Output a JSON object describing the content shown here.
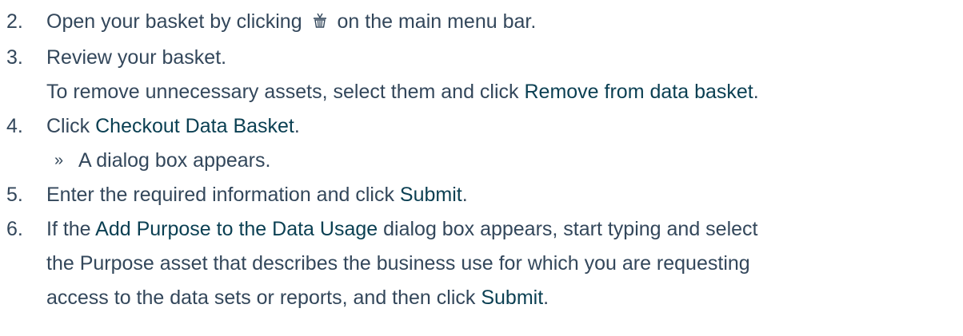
{
  "steps": [
    {
      "number": "2.",
      "text_before": "Open your basket by clicking",
      "icon": "basket-icon",
      "text_after": "on the main menu bar."
    },
    {
      "number": "3.",
      "text": "Review your basket.",
      "continuation_before": "To remove unnecessary assets, select them and click",
      "continuation_ui": "Remove from data basket",
      "continuation_after": "."
    },
    {
      "number": "4.",
      "text_before": "Click",
      "ui": "Checkout Data Basket",
      "text_after": ".",
      "result_marker": "»",
      "result_text": "A dialog box appears."
    },
    {
      "number": "5.",
      "text_before": "Enter the required information and click",
      "ui": "Submit",
      "text_after": "."
    },
    {
      "number": "6.",
      "line1_before": "If the",
      "line1_ui": "Add Purpose to the Data Usage",
      "line1_after": "dialog box appears, start typing and select",
      "line2": "the Purpose asset that describes the business use for which you are requesting",
      "line3_before": "access to the data sets or reports, and then click",
      "line3_ui": "Submit",
      "line3_after": "."
    }
  ],
  "colors": {
    "text": "#33475b",
    "ui_text": "#0a3f52"
  }
}
